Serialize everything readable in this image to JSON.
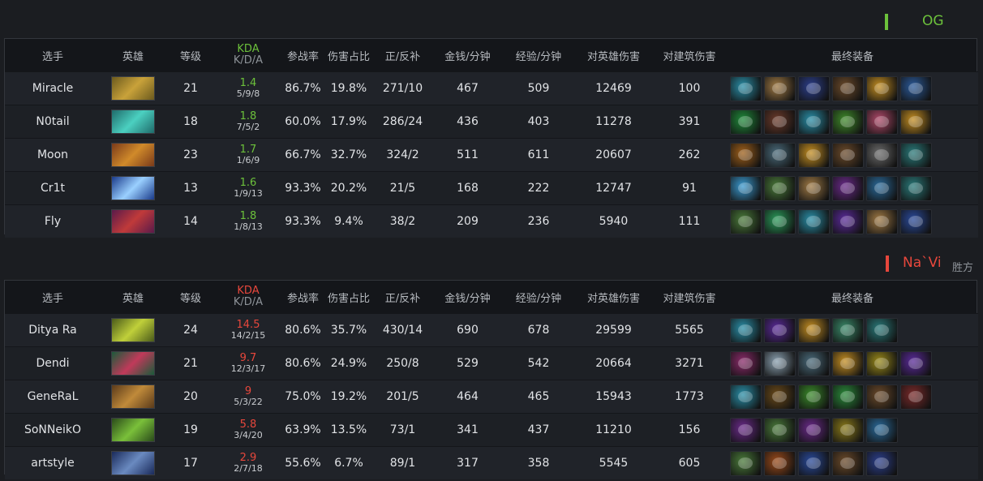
{
  "teams": [
    {
      "name": "OG",
      "result": "",
      "accent": "#6cc13b",
      "headers": [
        "选手",
        "英雄",
        "等级",
        "KDA",
        "K/D/A",
        "参战率",
        "伤害占比",
        "正/反补",
        "金钱/分钟",
        "经验/分钟",
        "对英雄伤害",
        "对建筑伤害",
        "最终装备"
      ],
      "players": [
        {
          "player": "Miracle",
          "hero_colors": [
            "#6b5a1e",
            "#c9a23a"
          ],
          "level": "21",
          "kda": "1.4",
          "kda_detail": "5/9/8",
          "participation": "86.7%",
          "damage_share": "19.8%",
          "lh_dn": "271/10",
          "gpm": "467",
          "xpm": "509",
          "hero_damage": "12469",
          "building_damage": "100",
          "items": [
            {
              "name": "battlefury-icon",
              "color": "#2a8fa8"
            },
            {
              "name": "scroll-icon",
              "color": "#a07a45"
            },
            {
              "name": "staff-icon",
              "color": "#2c3f8c"
            },
            {
              "name": "boots-icon",
              "color": "#6b4a2a"
            },
            {
              "name": "helm-icon",
              "color": "#c48e22"
            },
            {
              "name": "orb-icon",
              "color": "#2b5a9a"
            }
          ]
        },
        {
          "player": "N0tail",
          "hero_colors": [
            "#1f6b6b",
            "#4bd0c0"
          ],
          "level": "18",
          "kda": "1.8",
          "kda_detail": "7/5/2",
          "participation": "60.0%",
          "damage_share": "17.9%",
          "lh_dn": "286/24",
          "gpm": "436",
          "xpm": "403",
          "hero_damage": "11278",
          "building_damage": "391",
          "items": [
            {
              "name": "green-ring-icon",
              "color": "#1f8a3a"
            },
            {
              "name": "boots-icon",
              "color": "#6b3a2a"
            },
            {
              "name": "battlefury-icon",
              "color": "#2a8fa8"
            },
            {
              "name": "green-orb-icon",
              "color": "#3f8a2a"
            },
            {
              "name": "flower-icon",
              "color": "#b04a6a"
            },
            {
              "name": "helm-icon",
              "color": "#c48e22"
            }
          ]
        },
        {
          "player": "Moon",
          "hero_colors": [
            "#7a3a1a",
            "#d08a2a"
          ],
          "level": "23",
          "kda": "1.7",
          "kda_detail": "1/6/9",
          "participation": "66.7%",
          "damage_share": "32.7%",
          "lh_dn": "324/2",
          "gpm": "511",
          "xpm": "611",
          "hero_damage": "20607",
          "building_damage": "262",
          "items": [
            {
              "name": "gauntlet-icon",
              "color": "#a0601a"
            },
            {
              "name": "skull-icon",
              "color": "#4a6a7a"
            },
            {
              "name": "helm-icon",
              "color": "#c48e22"
            },
            {
              "name": "boots-icon",
              "color": "#6b4a2a"
            },
            {
              "name": "axe-icon",
              "color": "#6a6a6a"
            },
            {
              "name": "mask-icon",
              "color": "#2a7a7a"
            }
          ]
        },
        {
          "player": "Cr1t",
          "hero_colors": [
            "#1a3a8a",
            "#9ad0ff"
          ],
          "level": "13",
          "kda": "1.6",
          "kda_detail": "1/9/13",
          "participation": "93.3%",
          "damage_share": "20.2%",
          "lh_dn": "21/5",
          "gpm": "168",
          "xpm": "222",
          "hero_damage": "12747",
          "building_damage": "91",
          "items": [
            {
              "name": "crystal-icon",
              "color": "#3a9ad0"
            },
            {
              "name": "wand-icon",
              "color": "#4a7a3a"
            },
            {
              "name": "scroll-icon",
              "color": "#a07a45"
            },
            {
              "name": "pouch-icon",
              "color": "#6a2a8a"
            },
            {
              "name": "orb-icon",
              "color": "#2a6a9a"
            },
            {
              "name": "mask-icon",
              "color": "#2a7a7a"
            }
          ]
        },
        {
          "player": "Fly",
          "hero_colors": [
            "#5a1a4a",
            "#c03a3a"
          ],
          "level": "14",
          "kda": "1.8",
          "kda_detail": "1/8/13",
          "participation": "93.3%",
          "damage_share": "9.4%",
          "lh_dn": "38/2",
          "gpm": "209",
          "xpm": "236",
          "hero_damage": "5940",
          "building_damage": "111",
          "items": [
            {
              "name": "wand-icon",
              "color": "#4a7a3a"
            },
            {
              "name": "leaf-icon",
              "color": "#2a9a5a"
            },
            {
              "name": "battlefury-icon",
              "color": "#2a8fa8"
            },
            {
              "name": "purple-orb-icon",
              "color": "#5a2a9a"
            },
            {
              "name": "scroll-icon",
              "color": "#a07a45"
            },
            {
              "name": "skull-icon",
              "color": "#2a4a9a"
            }
          ]
        }
      ]
    },
    {
      "name": "Na`Vi",
      "result": "胜方",
      "accent": "#e7473c",
      "headers": [
        "选手",
        "英雄",
        "等级",
        "KDA",
        "K/D/A",
        "参战率",
        "伤害占比",
        "正/反补",
        "金钱/分钟",
        "经验/分钟",
        "对英雄伤害",
        "对建筑伤害",
        "最终装备"
      ],
      "players": [
        {
          "player": "Ditya Ra",
          "hero_colors": [
            "#4a5a1a",
            "#c0d03a"
          ],
          "level": "24",
          "kda": "14.5",
          "kda_detail": "14/2/15",
          "participation": "80.6%",
          "damage_share": "35.7%",
          "lh_dn": "430/14",
          "gpm": "690",
          "xpm": "678",
          "hero_damage": "29599",
          "building_damage": "5565",
          "items": [
            {
              "name": "battlefury-icon",
              "color": "#2a8fa8"
            },
            {
              "name": "purple-claw-icon",
              "color": "#5a2a9a"
            },
            {
              "name": "helm-icon",
              "color": "#c48e22"
            },
            {
              "name": "ghost-icon",
              "color": "#3a8a6a"
            },
            {
              "name": "mask-icon",
              "color": "#2a7a7a"
            }
          ]
        },
        {
          "player": "Dendi",
          "hero_colors": [
            "#1a5a3a",
            "#c03a5a"
          ],
          "level": "21",
          "kda": "9.7",
          "kda_detail": "12/3/17",
          "participation": "80.6%",
          "damage_share": "24.9%",
          "lh_dn": "250/8",
          "gpm": "529",
          "xpm": "542",
          "hero_damage": "20664",
          "building_damage": "3271",
          "items": [
            {
              "name": "gem-icon",
              "color": "#8a2a6a"
            },
            {
              "name": "swirl-icon",
              "color": "#8aa0b0"
            },
            {
              "name": "skull-icon",
              "color": "#4a6a7a"
            },
            {
              "name": "helm-icon",
              "color": "#c48e22"
            },
            {
              "name": "cup-icon",
              "color": "#9a8a1a"
            },
            {
              "name": "purple-claw-icon",
              "color": "#5a2a9a"
            }
          ]
        },
        {
          "player": "GeneRaL",
          "hero_colors": [
            "#5a3a1a",
            "#c08a3a"
          ],
          "level": "20",
          "kda": "9",
          "kda_detail": "5/3/22",
          "participation": "75.0%",
          "damage_share": "19.2%",
          "lh_dn": "201/5",
          "gpm": "464",
          "xpm": "465",
          "hero_damage": "15943",
          "building_damage": "1773",
          "items": [
            {
              "name": "battlefury-icon",
              "color": "#2a8fa8"
            },
            {
              "name": "book-icon",
              "color": "#6a4a1a"
            },
            {
              "name": "green-swirl-icon",
              "color": "#3a8a2a"
            },
            {
              "name": "green-gem-icon",
              "color": "#2a8a3a"
            },
            {
              "name": "boots-icon",
              "color": "#6b4a2a"
            },
            {
              "name": "demon-mask-icon",
              "color": "#7a2a2a"
            }
          ]
        },
        {
          "player": "SoNNeikO",
          "hero_colors": [
            "#2a4a1a",
            "#7ac03a"
          ],
          "level": "19",
          "kda": "5.8",
          "kda_detail": "3/4/20",
          "participation": "63.9%",
          "damage_share": "13.5%",
          "lh_dn": "73/1",
          "gpm": "341",
          "xpm": "437",
          "hero_damage": "11210",
          "building_damage": "156",
          "items": [
            {
              "name": "purple-cloak-icon",
              "color": "#6a2a8a"
            },
            {
              "name": "wand-icon",
              "color": "#4a7a3a"
            },
            {
              "name": "pouch-icon",
              "color": "#6a2a8a"
            },
            {
              "name": "staff-icon",
              "color": "#8a7a1a"
            },
            {
              "name": "orb-icon",
              "color": "#2a6a9a"
            }
          ]
        },
        {
          "player": "artstyle",
          "hero_colors": [
            "#1a2a5a",
            "#6a8ac0"
          ],
          "level": "17",
          "kda": "2.9",
          "kda_detail": "2/7/18",
          "participation": "55.6%",
          "damage_share": "6.7%",
          "lh_dn": "89/1",
          "gpm": "317",
          "xpm": "358",
          "hero_damage": "5545",
          "building_damage": "605",
          "items": [
            {
              "name": "wand-icon",
              "color": "#4a7a3a"
            },
            {
              "name": "armor-icon",
              "color": "#9a4a1a"
            },
            {
              "name": "wings-icon",
              "color": "#2a4a9a"
            },
            {
              "name": "boots-icon",
              "color": "#6b4a2a"
            },
            {
              "name": "staff-icon",
              "color": "#2c3f8c"
            }
          ]
        }
      ]
    }
  ]
}
